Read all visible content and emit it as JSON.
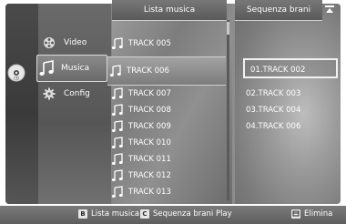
{
  "headers": {
    "music_list": "Lista musica",
    "track_sequence": "Sequenza brani"
  },
  "menu": [
    {
      "label": "Video",
      "icon": "film-reel-icon",
      "selected": false
    },
    {
      "label": "Musica",
      "icon": "music-note-icon",
      "selected": true
    },
    {
      "label": "Config",
      "icon": "gear-icon",
      "selected": false
    }
  ],
  "tracks": [
    {
      "label": "TRACK 005",
      "selected": false
    },
    {
      "label": "TRACK 006",
      "selected": true
    },
    {
      "label": "TRACK 007",
      "selected": false
    },
    {
      "label": "TRACK 008",
      "selected": false
    },
    {
      "label": "TRACK 009",
      "selected": false
    },
    {
      "label": "TRACK 010",
      "selected": false
    },
    {
      "label": "TRACK 011",
      "selected": false
    },
    {
      "label": "TRACK 012",
      "selected": false
    },
    {
      "label": "TRACK 013",
      "selected": false
    }
  ],
  "sequence": [
    {
      "label": "01.TRACK 002",
      "selected": true
    },
    {
      "label": "02.TRACK 003",
      "selected": false
    },
    {
      "label": "03.TRACK 004",
      "selected": false
    },
    {
      "label": "04.TRACK 006",
      "selected": false
    }
  ],
  "footer": {
    "key_b": "B",
    "lista_musica": "Lista musica",
    "key_c": "C",
    "sequenza_play": "Sequenza brani Play",
    "elimina": "Elimina"
  },
  "colors": {
    "panel_dark": "#5a5a5a",
    "highlight_border": "#f2f2f2",
    "text": "#ffffff"
  }
}
